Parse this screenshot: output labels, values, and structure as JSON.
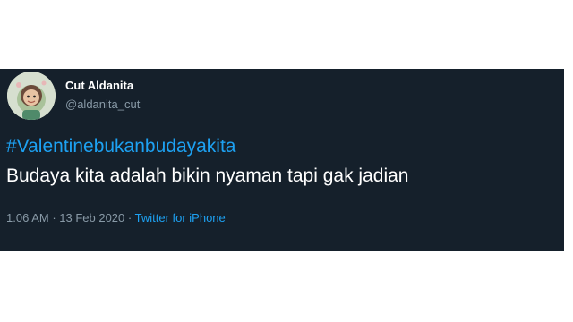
{
  "tweet": {
    "author": {
      "display_name": "Cut Aldanita",
      "handle": "@aldanita_cut",
      "avatar_icon": "avatar-illustration"
    },
    "hashtag": "#Valentinebukanbudayakita",
    "text": "Budaya kita adalah bikin nyaman tapi gak jadian",
    "time": "1.06 AM",
    "separator": " · ",
    "date": "13 Feb 2020",
    "source": "Twitter for iPhone"
  },
  "colors": {
    "background": "#15202b",
    "primary_text": "#ffffff",
    "secondary_text": "#8899a6",
    "link": "#1da1f2"
  }
}
